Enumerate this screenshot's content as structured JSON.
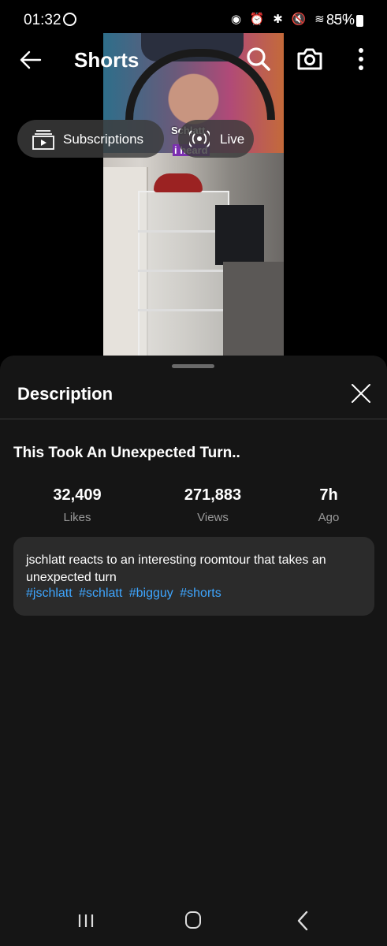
{
  "status_bar": {
    "time": "01:32",
    "icons": "◉ ⏰ ✱ 🔇 ≋ .ıl",
    "battery": "85%"
  },
  "header": {
    "title": "Shorts",
    "icons": [
      "back-arrow-icon",
      "search-icon",
      "camera-icon",
      "more-vertical-icon"
    ]
  },
  "chips": [
    {
      "label": "Subscriptions",
      "icon": "subscriptions-icon"
    },
    {
      "label": "Live",
      "icon": "live-icon"
    }
  ],
  "video_overlay": {
    "caption_line1": "Schlatt",
    "caption_line2": "i heard"
  },
  "description_sheet": {
    "heading": "Description",
    "video_title": "This Took An Unexpected Turn..",
    "stats": [
      {
        "value": "32,409",
        "label": "Likes"
      },
      {
        "value": "271,883",
        "label": "Views"
      },
      {
        "value": "7h",
        "label": "Ago"
      }
    ],
    "description": "jschlatt reacts to an interesting roomtour that takes an unexpected turn",
    "hashtags": [
      "#jschlatt",
      "#schlatt",
      "#bigguy",
      "#shorts"
    ],
    "accent_color": "#3ea6ff"
  },
  "nav_bar": {
    "icons": [
      "recent-apps-icon",
      "home-icon",
      "back-icon"
    ]
  }
}
